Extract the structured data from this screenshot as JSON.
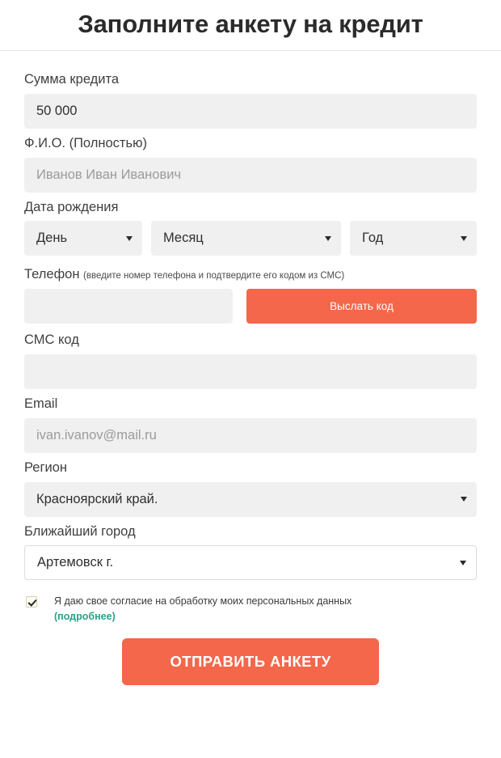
{
  "header": {
    "title": "Заполните анкету на кредит"
  },
  "form": {
    "amount": {
      "label": "Сумма кредита",
      "value": "50 000",
      "placeholder": ""
    },
    "fullname": {
      "label": "Ф.И.О. (Полностью)",
      "value": "",
      "placeholder": "Иванов Иван Иванович"
    },
    "birthdate": {
      "label": "Дата рождения",
      "day": "День",
      "month": "Месяц",
      "year": "Год"
    },
    "phone": {
      "label": "Телефон",
      "hint": "(введите номер телефона и подтвердите его кодом из СМС)",
      "value": "",
      "placeholder": "",
      "send_code_label": "Выслать код"
    },
    "sms_code": {
      "label": "СМС код",
      "value": "",
      "placeholder": ""
    },
    "email": {
      "label": "Email",
      "value": "",
      "placeholder": "ivan.ivanov@mail.ru"
    },
    "region": {
      "label": "Регион",
      "value": "Красноярский край."
    },
    "city": {
      "label": "Ближайший город",
      "value": "Артемовск г."
    },
    "consent": {
      "text": "Я даю свое согласие на обработку моих персональных данных",
      "link_label": "(подробнее)",
      "checked": true
    },
    "submit_label": "ОТПРАВИТЬ АНКЕТУ"
  },
  "colors": {
    "accent_orange": "#f4674a",
    "link_green": "#28a387",
    "input_bg": "#f0f0f0"
  }
}
